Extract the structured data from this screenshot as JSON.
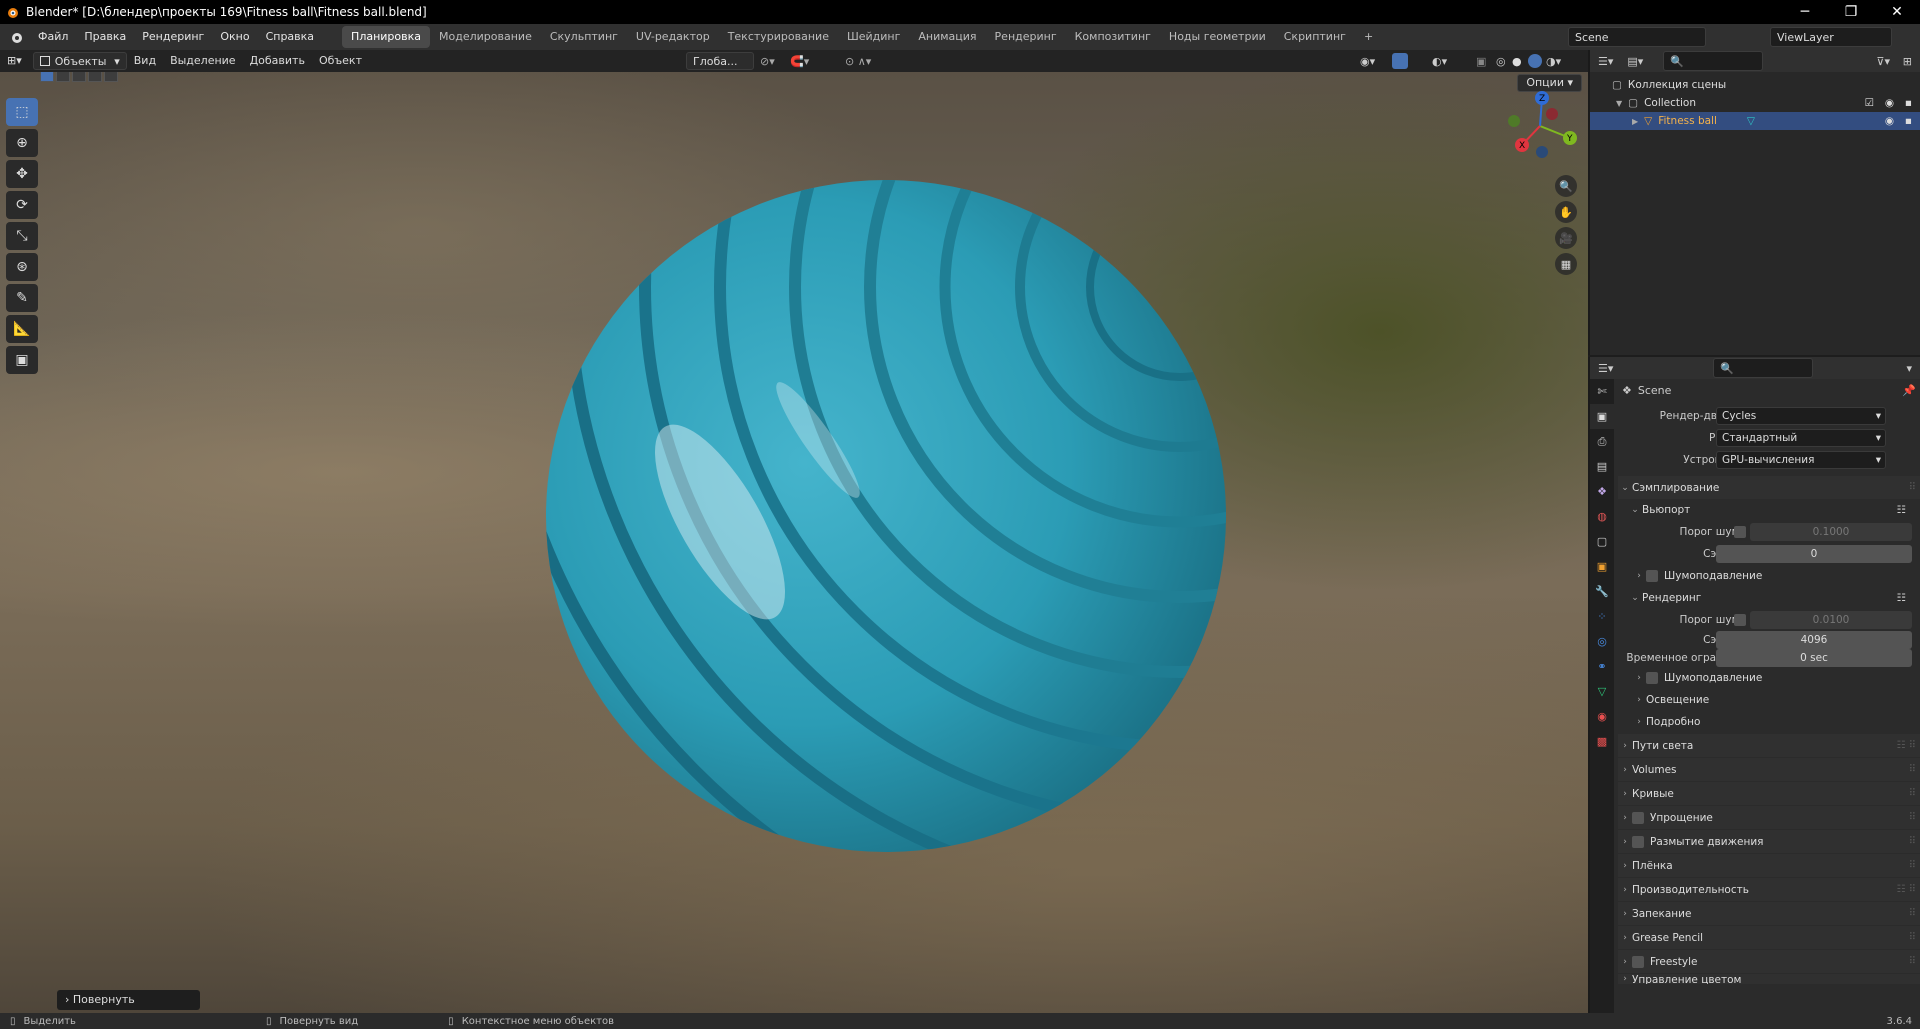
{
  "titlebar": {
    "title": "Blender* [D:\\блендер\\проекты 169\\Fitness ball\\Fitness ball.blend]"
  },
  "menu": [
    "Файл",
    "Правка",
    "Рендеринг",
    "Окно",
    "Справка"
  ],
  "workspaces": [
    "Планировка",
    "Моделирование",
    "Скульптинг",
    "UV-редактор",
    "Текстурирование",
    "Шейдинг",
    "Анимация",
    "Рендеринг",
    "Композитинг",
    "Ноды геометрии",
    "Скриптинг"
  ],
  "scene": {
    "scene_name": "Scene",
    "view_layer": "ViewLayer"
  },
  "viewport": {
    "mode": "Объекты",
    "menus": [
      "Вид",
      "Выделение",
      "Добавить",
      "Объект"
    ],
    "orientation": "Глоба...",
    "options": "Опции",
    "operator_panel": "Повернуть"
  },
  "outliner": {
    "root": "Коллекция сцены",
    "collection": "Collection",
    "object": "Fitness ball"
  },
  "properties": {
    "scene": "Scene",
    "render_engine_label": "Рендер-движок",
    "render_engine": "Cycles",
    "mode_label": "Режим",
    "mode": "Стандартный",
    "device_label": "Устройство",
    "device": "GPU-вычисления",
    "sampling": "Сэмплирование",
    "viewport": "Вьюпорт",
    "noise_threshold_label": "Порог шума",
    "vp_noise": "0.1000",
    "samples_label": "Сэмплы",
    "vp_samples": "0",
    "denoise": "Шумоподавление",
    "render": "Рендеринг",
    "r_noise": "0.0100",
    "r_samples": "4096",
    "time_limit_label": "Временное огранич...",
    "time_limit": "0 sec",
    "lights": "Освещение",
    "advanced": "Подробно",
    "panels": [
      "Пути света",
      "Volumes",
      "Кривые",
      "Упрощение",
      "Размытие движения",
      "Плёнка",
      "Производительность",
      "Запекание",
      "Grease Pencil",
      "Freestyle",
      "Управление цветом"
    ]
  },
  "status": {
    "select": "Выделить",
    "rotate": "Повернуть вид",
    "context": "Контекстное меню объектов",
    "version": "3.6.4"
  }
}
